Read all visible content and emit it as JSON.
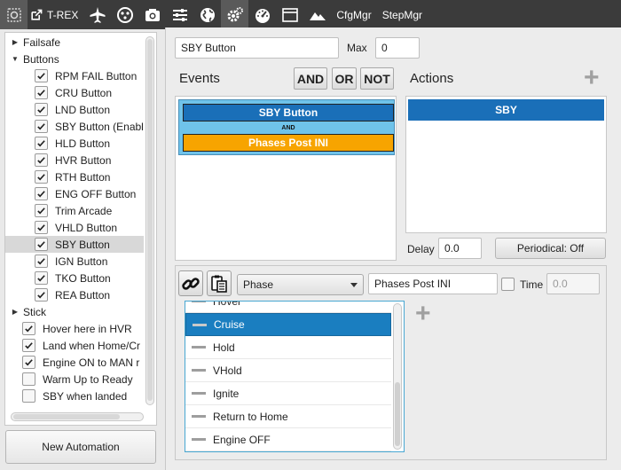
{
  "toolbar": {
    "title": "T-REX",
    "cfg_label": "CfgMgr",
    "step_label": "StepMgr"
  },
  "tree": {
    "items": [
      {
        "label": "Failsafe",
        "type": "group",
        "expanded": false
      },
      {
        "label": "Buttons",
        "type": "group",
        "expanded": true
      },
      {
        "label": "RPM FAIL Button",
        "type": "item",
        "checked": true
      },
      {
        "label": "CRU Button",
        "type": "item",
        "checked": true
      },
      {
        "label": "LND Button",
        "type": "item",
        "checked": true
      },
      {
        "label": "SBY Button (Enable",
        "type": "item",
        "checked": true
      },
      {
        "label": "HLD Button",
        "type": "item",
        "checked": true
      },
      {
        "label": "HVR Button",
        "type": "item",
        "checked": true
      },
      {
        "label": "RTH Button",
        "type": "item",
        "checked": true
      },
      {
        "label": "ENG OFF Button",
        "type": "item",
        "checked": true
      },
      {
        "label": "Trim Arcade",
        "type": "item",
        "checked": true
      },
      {
        "label": "VHLD Button",
        "type": "item",
        "checked": true
      },
      {
        "label": "SBY Button",
        "type": "item",
        "checked": true,
        "selected": true
      },
      {
        "label": "IGN Button",
        "type": "item",
        "checked": true
      },
      {
        "label": "TKO Button",
        "type": "item",
        "checked": true
      },
      {
        "label": "REA Button",
        "type": "item",
        "checked": true
      },
      {
        "label": "Stick",
        "type": "group",
        "expanded": false
      },
      {
        "label": "Hover here in HVR",
        "type": "item0",
        "checked": true
      },
      {
        "label": "Land when Home/Cr",
        "type": "item0",
        "checked": true
      },
      {
        "label": "Engine ON to MAN r",
        "type": "item0",
        "checked": true
      },
      {
        "label": "Warm Up to Ready",
        "type": "item0",
        "checked": false
      },
      {
        "label": "SBY when landed",
        "type": "item0",
        "checked": false
      }
    ]
  },
  "new_automation_label": "New Automation",
  "editor": {
    "name_value": "SBY Button",
    "max_label": "Max",
    "max_value": "0",
    "events_label": "Events",
    "and_label": "AND",
    "or_label": "OR",
    "not_label": "NOT",
    "actions_label": "Actions",
    "event_1": "SBY Button",
    "event_op": "AND",
    "event_2": "Phases Post INI",
    "action_1": "SBY",
    "delay_label": "Delay",
    "delay_value": "0.0",
    "periodical_label": "Periodical: Off",
    "condition_select": "Phase",
    "condition_value": "Phases Post INI",
    "time_label": "Time",
    "time_value": "0.0"
  },
  "dropdown": {
    "items": [
      "Hover",
      "Cruise",
      "Hold",
      "VHold",
      "Ignite",
      "Return to Home",
      "Engine OFF"
    ],
    "selected": "Cruise"
  },
  "colors": {
    "event_blue": "#1a6fb8",
    "event_orange": "#f7a400",
    "event_group": "#6fc3ea",
    "toolbar": "#3b3b3b"
  }
}
